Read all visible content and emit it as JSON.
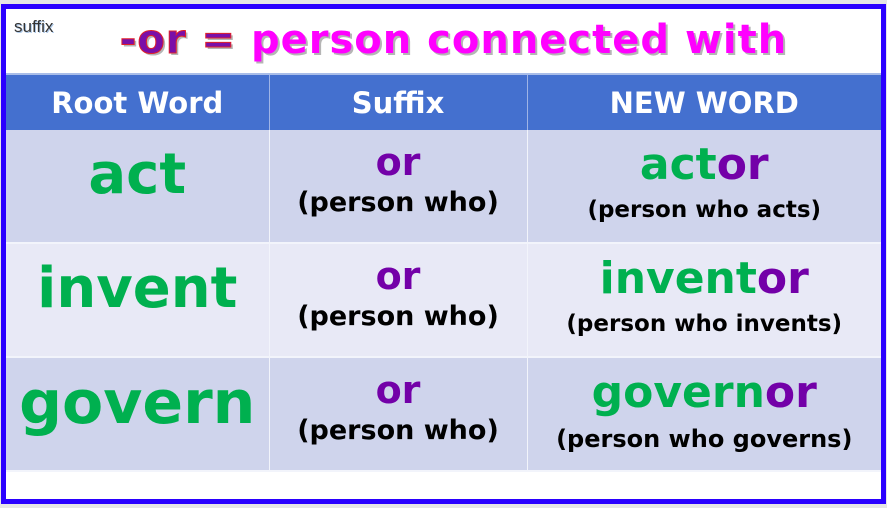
{
  "slide": {
    "tag": "suffix",
    "title": {
      "suffix_part": "-or =",
      "definition_part": "person connected with"
    }
  },
  "colors": {
    "frame": "#2a00ff",
    "header_bg": "#4470cf",
    "root_green": "#00b04f",
    "suffix_purple": "#7300a8",
    "title_magenta": "#ff00ff"
  },
  "table": {
    "headers": [
      "Root Word",
      "Suffix",
      "NEW WORD"
    ],
    "rows": [
      {
        "root": "act",
        "suffix": "or",
        "suffix_note": "(person who)",
        "new_stem": "act",
        "new_suffix": "or",
        "new_note": "(person who acts)"
      },
      {
        "root": "invent",
        "suffix": "or",
        "suffix_note": "(person who)",
        "new_stem": "invent",
        "new_suffix": "or",
        "new_note": "(person who invents)"
      },
      {
        "root": "govern",
        "suffix": "or",
        "suffix_note": "(person who)",
        "new_stem": "govern",
        "new_suffix": "or",
        "new_note": "(person who governs)"
      }
    ]
  }
}
